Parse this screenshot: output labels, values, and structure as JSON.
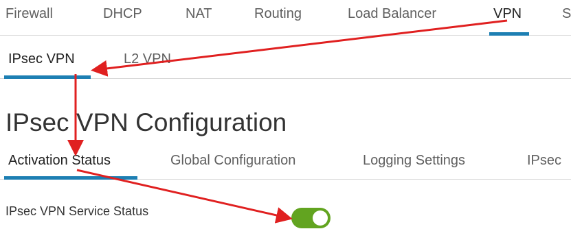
{
  "top_nav": {
    "tabs": [
      {
        "label": "Firewall"
      },
      {
        "label": "DHCP"
      },
      {
        "label": "NAT"
      },
      {
        "label": "Routing"
      },
      {
        "label": "Load Balancer"
      },
      {
        "label": "VPN",
        "active": true
      },
      {
        "label": "S"
      }
    ]
  },
  "vpn_tabs": {
    "tabs": [
      {
        "label": "IPsec VPN",
        "active": true
      },
      {
        "label": "L2 VPN"
      }
    ]
  },
  "page": {
    "title": "IPsec VPN Configuration"
  },
  "config_tabs": {
    "tabs": [
      {
        "label": "Activation Status",
        "active": true
      },
      {
        "label": "Global Configuration"
      },
      {
        "label": "Logging Settings"
      },
      {
        "label": "IPsec"
      }
    ]
  },
  "service_status": {
    "label": "IPsec VPN Service Status",
    "enabled": true
  },
  "colors": {
    "accent_underline": "#1d7fb3",
    "toggle_on": "#62a420",
    "annotation_arrow": "#e02020"
  }
}
